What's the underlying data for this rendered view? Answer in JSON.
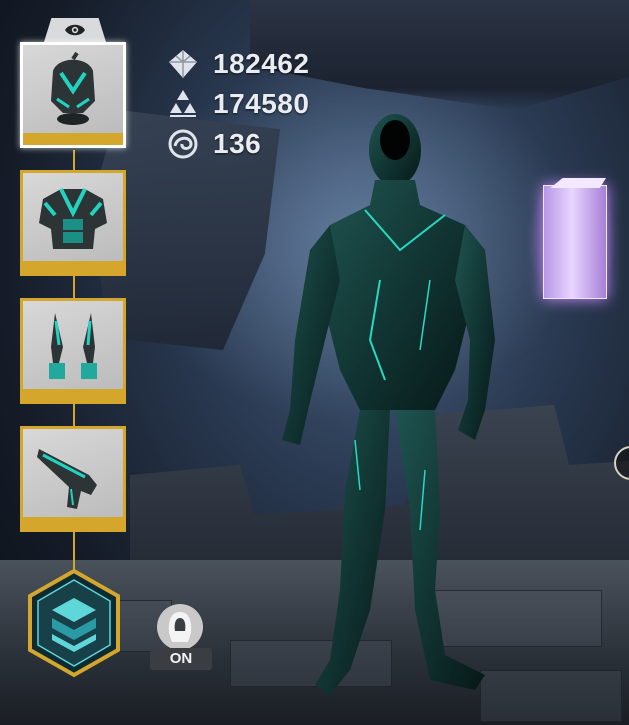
{
  "currencies": [
    {
      "icon": "diamond-stack-icon",
      "value": "182462"
    },
    {
      "icon": "triangle-stack-icon",
      "value": "174580"
    },
    {
      "icon": "swirl-orb-icon",
      "value": "136"
    }
  ],
  "equipment": {
    "visibility_icon": "eye-icon",
    "slots": [
      {
        "name": "helmet",
        "icon": "helmet-icon",
        "selected": true
      },
      {
        "name": "armor",
        "icon": "chest-armor-icon",
        "selected": false
      },
      {
        "name": "ranged-weapon",
        "icon": "twin-blades-icon",
        "selected": false
      },
      {
        "name": "melee-weapon",
        "icon": "blaster-icon",
        "selected": false
      }
    ],
    "set_button_icon": "armor-set-hex-icon"
  },
  "toggle": {
    "icon": "hood-icon",
    "label": "ON"
  },
  "colors": {
    "gold": "#d4a72c",
    "teal": "#18c7b8",
    "crystal": "#d6b8ff"
  }
}
